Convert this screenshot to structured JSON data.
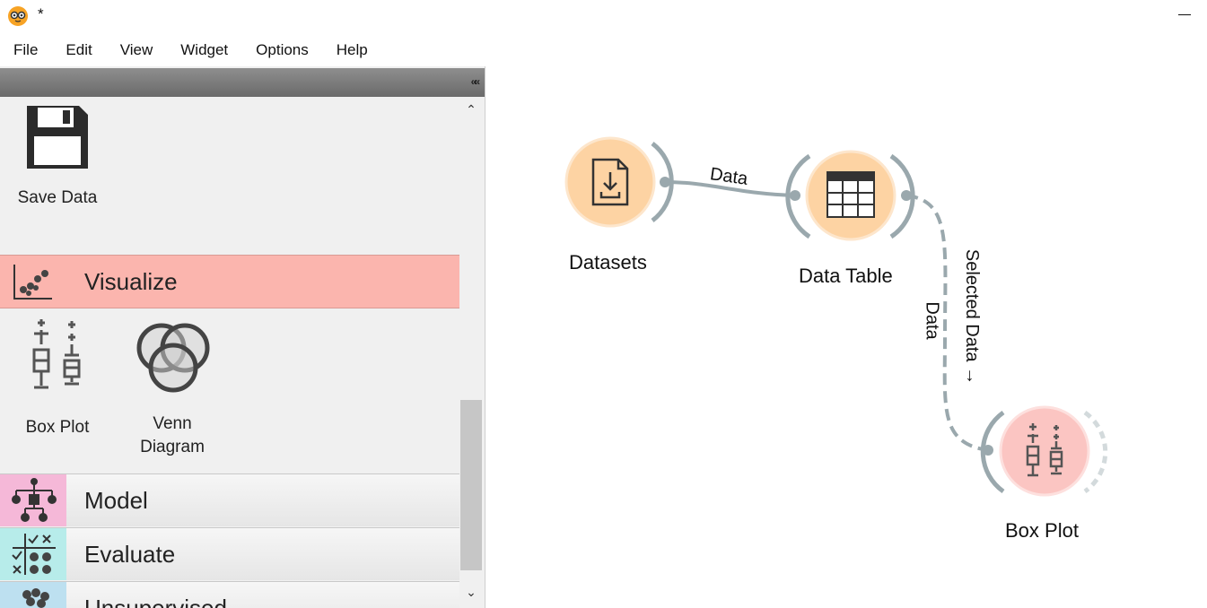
{
  "window": {
    "title": "*"
  },
  "menu": [
    "File",
    "Edit",
    "View",
    "Widget",
    "Options",
    "Help"
  ],
  "toolbox": {
    "widgets_top": [
      {
        "label": "Save Data",
        "icon": "save-icon"
      }
    ],
    "categories": {
      "visualize": {
        "label": "Visualize",
        "color": "#fbb5ae"
      },
      "model": {
        "label": "Model",
        "color": "#f5b8d8"
      },
      "evaluate": {
        "label": "Evaluate",
        "color": "#b7ecea"
      },
      "unsupervised": {
        "label": "Unsupervised",
        "color": "#bde0f0"
      }
    },
    "visualize_widgets": [
      {
        "label": "Box Plot",
        "icon": "box-plot-icon"
      },
      {
        "label": "Venn\nDiagram",
        "icon": "venn-diagram-icon"
      }
    ]
  },
  "canvas": {
    "nodes": {
      "datasets": {
        "label": "Datasets",
        "color": "#fdd3a3"
      },
      "data_table": {
        "label": "Data Table",
        "color": "#fdd3a3"
      },
      "box_plot": {
        "label": "Box Plot",
        "color": "#fbc5c2"
      }
    },
    "links": {
      "datasets_to_table": {
        "label": "Data"
      },
      "table_to_boxplot": {
        "label_line1": "Selected Data →",
        "label_line2": "Data"
      }
    }
  }
}
